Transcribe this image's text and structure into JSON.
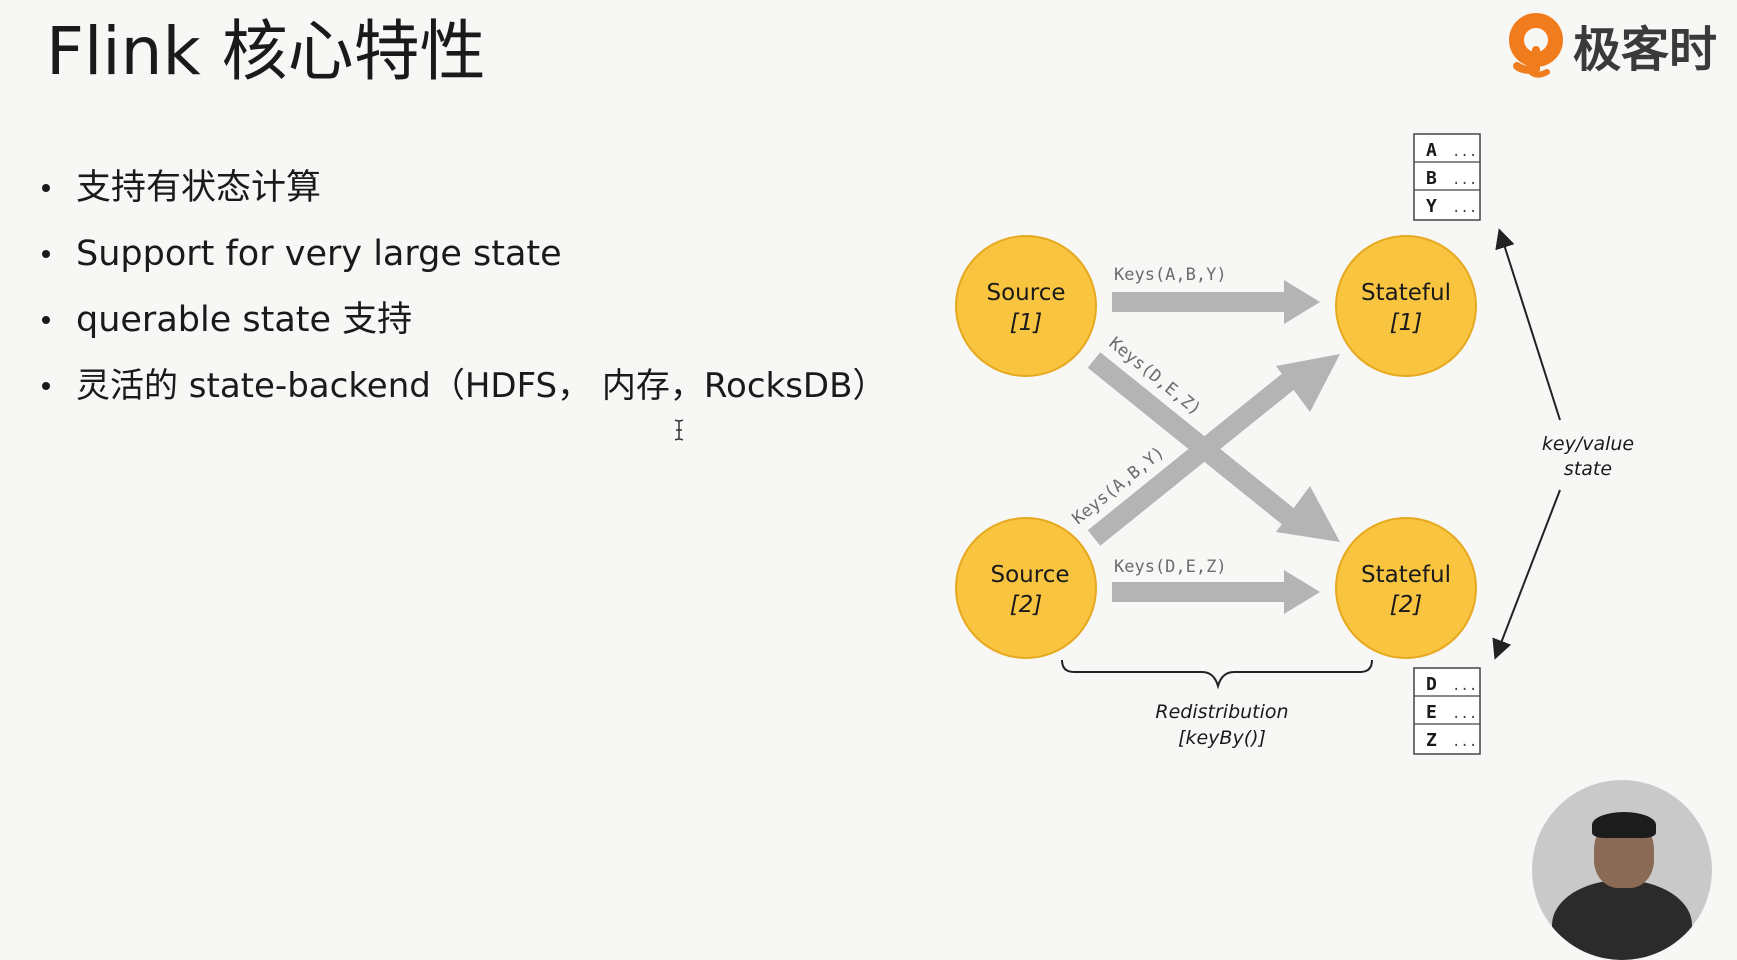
{
  "slide": {
    "title": "Flink 核心特性",
    "logo_text": "极客时",
    "bullets": [
      "支持有状态计算",
      "Support for very large state",
      "querable state 支持",
      "灵活的 state-backend（HDFS， 内存，RocksDB）"
    ]
  },
  "diagram": {
    "source1": {
      "name": "Source",
      "index": "[1]"
    },
    "source2": {
      "name": "Source",
      "index": "[2]"
    },
    "stateful1": {
      "name": "Stateful",
      "index": "[1]"
    },
    "stateful2": {
      "name": "Stateful",
      "index": "[2]"
    },
    "edge_top": "Keys(A,B,Y)",
    "edge_diag_down": "Keys(D,E,Z)",
    "edge_diag_up": "Keys(A,B,Y)",
    "edge_bottom": "Keys(D,E,Z)",
    "state_top": [
      {
        "key": "A",
        "value": "..."
      },
      {
        "key": "B",
        "value": "..."
      },
      {
        "key": "Y",
        "value": "..."
      }
    ],
    "state_bottom": [
      {
        "key": "D",
        "value": "..."
      },
      {
        "key": "E",
        "value": "..."
      },
      {
        "key": "Z",
        "value": "..."
      }
    ],
    "kv_label_line1": "key/value",
    "kv_label_line2": "state",
    "redistribution_line1": "Redistribution",
    "redistribution_line2": "[keyBy()]",
    "colors": {
      "node_fill": "#f9c440",
      "node_stroke": "#e6a920",
      "arrow": "#b4b4b4",
      "edge_label": "#6b6b6b",
      "logo_orange": "#f07c1e"
    }
  }
}
